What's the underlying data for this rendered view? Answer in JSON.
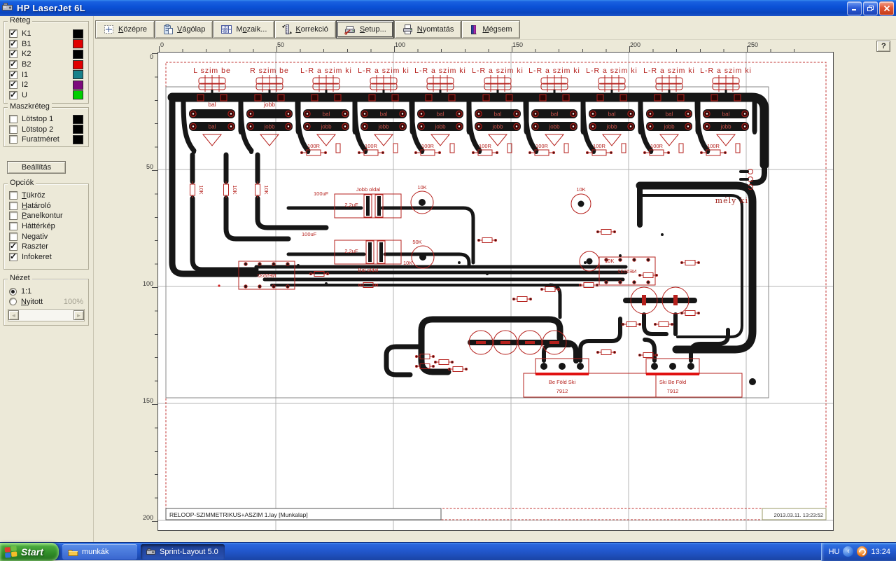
{
  "window": {
    "title": "HP LaserJet 6L",
    "help": "?"
  },
  "toolbar": {
    "buttons": [
      {
        "pre": "",
        "key": "K",
        "post": "özépre"
      },
      {
        "pre": "",
        "key": "V",
        "post": "ágólap"
      },
      {
        "pre": "M",
        "key": "o",
        "post": "zaik..."
      },
      {
        "pre": "",
        "key": "K",
        "post": "orrekció"
      },
      {
        "pre": "",
        "key": "S",
        "post": "etup..."
      },
      {
        "pre": "",
        "key": "N",
        "post": "yomtatás"
      },
      {
        "pre": "",
        "key": "M",
        "post": "égsem"
      }
    ]
  },
  "sidebar": {
    "layers_group": "Réteg",
    "layers": [
      {
        "label": "K1",
        "checked": true,
        "color": "#000000"
      },
      {
        "label": "B1",
        "checked": true,
        "color": "#e00000"
      },
      {
        "label": "K2",
        "checked": true,
        "color": "#000000"
      },
      {
        "label": "B2",
        "checked": true,
        "color": "#e00000"
      },
      {
        "label": "I1",
        "checked": true,
        "color": "#178089"
      },
      {
        "label": "I2",
        "checked": true,
        "color": "#7d0b7d"
      },
      {
        "label": "U",
        "checked": true,
        "color": "#00ce00"
      }
    ],
    "mask_group": "Maszkréteg",
    "masks": [
      {
        "label": "Lötstop 1",
        "checked": false,
        "color": "#000000"
      },
      {
        "label": "Lötstop 2",
        "checked": false,
        "color": "#000000"
      },
      {
        "label": "Furatméret",
        "checked": false,
        "color": "#000000"
      }
    ],
    "settings_button": "Beállítás",
    "options_group": "Opciók",
    "options": [
      {
        "pre": "",
        "key": "T",
        "post": "ükröz",
        "checked": false
      },
      {
        "pre": "",
        "key": "H",
        "post": "atároló",
        "checked": false
      },
      {
        "pre": "",
        "key": "P",
        "post": "anelkontur",
        "checked": false
      },
      {
        "pre": "Háttérkép",
        "key": "",
        "post": "",
        "checked": false
      },
      {
        "pre": "Negativ",
        "key": "",
        "post": "",
        "checked": false
      },
      {
        "pre": "Raszter",
        "key": "",
        "post": "",
        "checked": true
      },
      {
        "pre": "Infokeret",
        "key": "",
        "post": "",
        "checked": true
      }
    ],
    "view_group": "Nézet",
    "view_scale": {
      "pre": "1:1",
      "key": "",
      "post": "",
      "selected": true
    },
    "view_fit": {
      "pre": "",
      "key": "N",
      "post": "yitott",
      "selected": false
    },
    "zoom_percent": "100%"
  },
  "rulers": {
    "h": [
      "0",
      "50",
      "100",
      "150",
      "200",
      "250"
    ],
    "v": [
      "0",
      "50",
      "100",
      "150",
      "200"
    ]
  },
  "pcb": {
    "connector_labels": [
      "L szim be",
      "R szim be",
      "L-R a szim ki",
      "L-R a szim ki",
      "L-R a szim ki",
      "L-R a szim ki",
      "L-R a szim ki",
      "L-R a szim ki",
      "L-R a szim ki",
      "L-R a szim ki"
    ],
    "labels": {
      "bal": "bal",
      "jobb": "jobb",
      "r100": "100R",
      "k10": "10K",
      "k50": "50K",
      "c22": "2,2uF",
      "c100": "100uF",
      "ic": "NE5532",
      "jobb_oldal": "Jobb oldal",
      "bal_oldal": "Bal oldal",
      "mely_ki": "mély ki",
      "reg": "7912",
      "reg1_pins": "Be Föld Ski",
      "reg2_pins": "Ski Be Föld"
    },
    "footer": {
      "filename": "RELOOP-SZIMMETRIKUS+ASZIM 1.lay [Munkalap]",
      "timestamp": "2013.03.11. 13:23:52"
    }
  },
  "taskbar": {
    "start": "Start",
    "tasks": [
      {
        "label": "munkák",
        "active": false
      },
      {
        "label": "Sprint-Layout 5.0",
        "active": true
      }
    ],
    "tray": {
      "language": "HU",
      "time": "13:24"
    }
  }
}
